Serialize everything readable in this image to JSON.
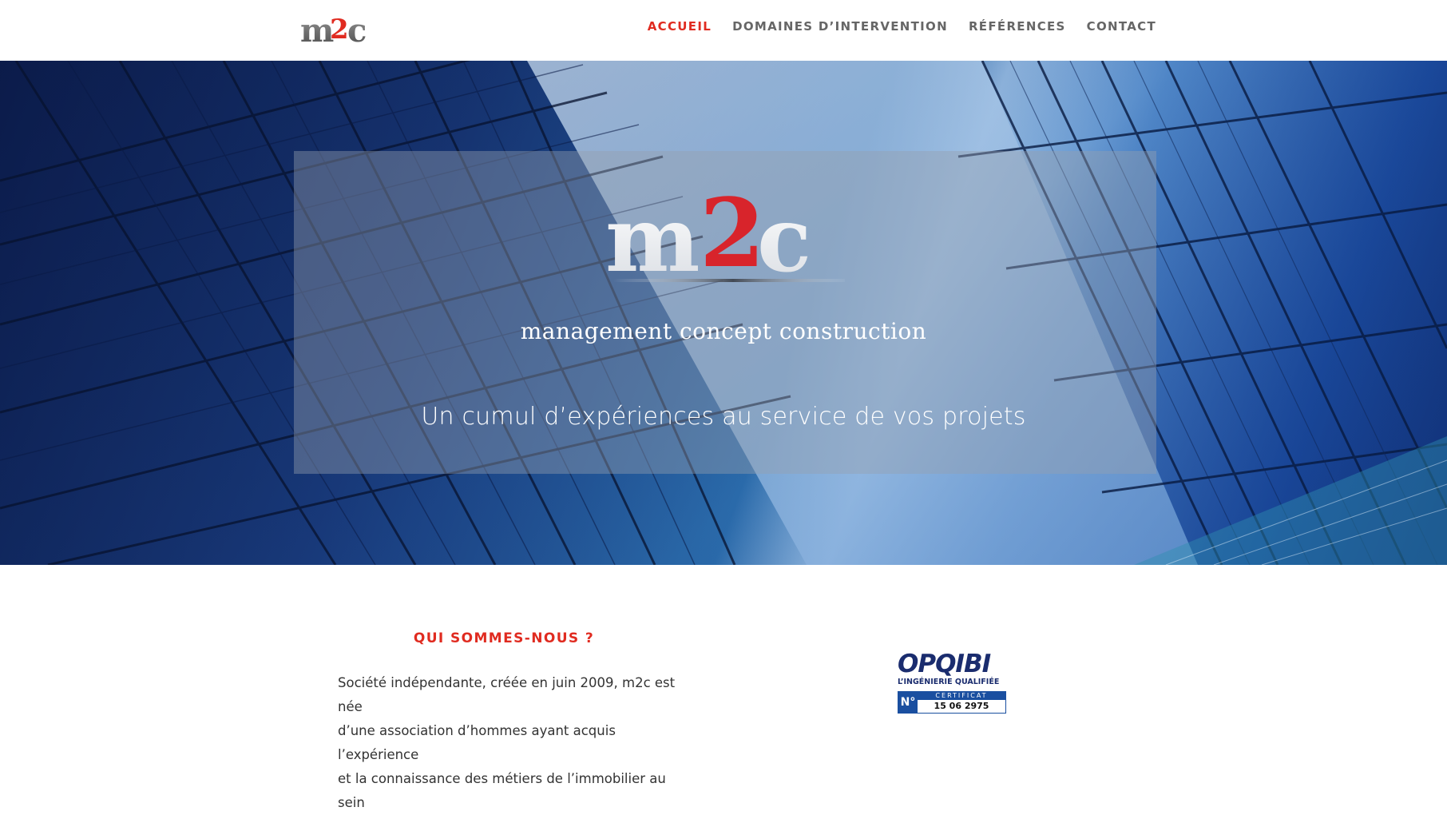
{
  "brand": {
    "logo_text": "m2c",
    "accent_color": "#e02b20"
  },
  "nav": {
    "items": [
      {
        "label": "ACCUEIL",
        "active": true
      },
      {
        "label": "DOMAINES D’INTERVENTION",
        "active": false
      },
      {
        "label": "RÉFÉRENCES",
        "active": false
      },
      {
        "label": "CONTACT",
        "active": false
      }
    ]
  },
  "hero": {
    "logo_text": "m2c",
    "brand_line": "management concept construction",
    "tagline": "Un cumul d’expériences au service de vos projets"
  },
  "about": {
    "title": "QUI SOMMES-NOUS ?",
    "lines": [
      "Société indépendante, créée en juin 2009, m2c est née",
      "d’une association d’hommes ayant acquis l’expérience",
      "et la connaissance des métiers de l’immobilier au sein"
    ]
  },
  "certificate": {
    "name": "OPQIBI",
    "subtitle": "L’INGÉNIERIE QUALIFIÉE",
    "number_prefix": "N°",
    "label": "CERTIFICAT",
    "number": "15 06 2975"
  }
}
